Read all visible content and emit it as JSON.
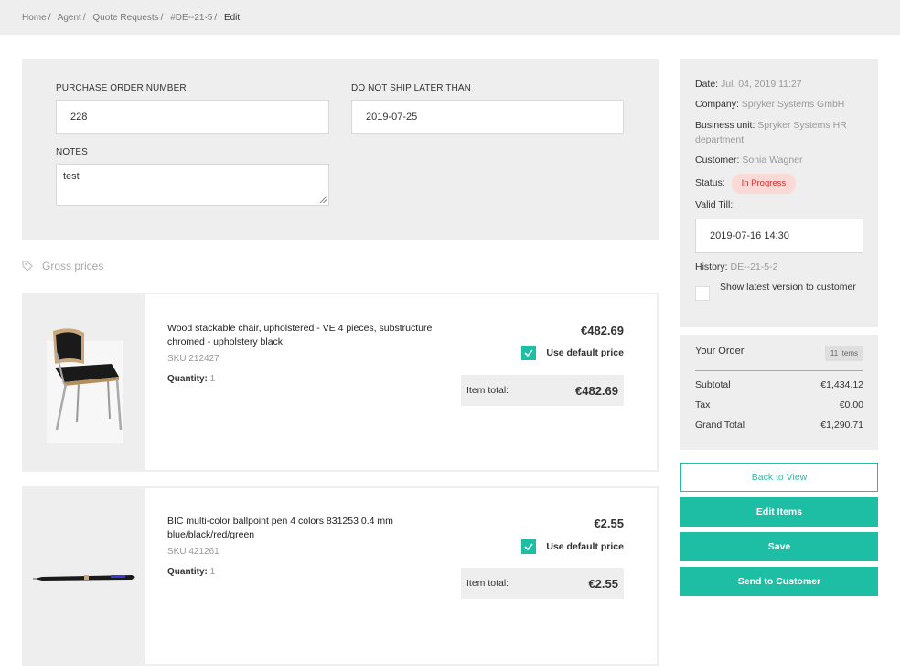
{
  "breadcrumb": [
    "Home",
    "Agent",
    "Quote Requests",
    "#DE--21-5",
    "Edit"
  ],
  "form": {
    "po_label": "PURCHASE ORDER NUMBER",
    "po_value": "228",
    "ship_label": "DO NOT SHIP LATER THAN",
    "ship_value": "2019-07-25",
    "notes_label": "NOTES",
    "notes_value": "test"
  },
  "gross_prices": "Gross prices",
  "items": [
    {
      "name": "Wood stackable chair, upholstered - VE 4 pieces, substructure chromed - upholstery black",
      "sku": "SKU 212427",
      "qty_label": "Quantity:",
      "qty": "1",
      "price": "€482.69",
      "default_price_label": "Use default price",
      "total_label": "Item total:",
      "total": "€482.69",
      "image": "chair-image"
    },
    {
      "name": "BIC multi-color ballpoint pen 4 colors 831253 0.4 mm blue/black/red/green",
      "sku": "SKU 421261",
      "qty_label": "Quantity:",
      "qty": "1",
      "price": "€2.55",
      "default_price_label": "Use default price",
      "total_label": "Item total:",
      "total": "€2.55",
      "image": "pen-image"
    }
  ],
  "info": {
    "date_label": "Date:",
    "date": "Jul. 04, 2019 11:27",
    "company_label": "Company:",
    "company": "Spryker Systems GmbH",
    "bu_label": "Business unit:",
    "bu": "Spryker Systems HR department",
    "customer_label": "Customer:",
    "customer": "Sonia Wagner",
    "status_label": "Status:",
    "status": "In Progress",
    "valid_label": "Valid Till:",
    "valid_value": "2019-07-16 14:30",
    "history_label": "History:",
    "history": "DE--21-5-2",
    "latest_label": "Show latest version to customer"
  },
  "order": {
    "title": "Your Order",
    "count": "11 Items",
    "subtotal_label": "Subtotal",
    "subtotal": "€1,434.12",
    "tax_label": "Tax",
    "tax": "€0.00",
    "grand_label": "Grand Total",
    "grand": "€1,290.71"
  },
  "buttons": {
    "back": "Back to View",
    "edit": "Edit Items",
    "save": "Save",
    "send": "Send to Customer"
  },
  "colors": {
    "accent": "#1ebea5",
    "panel": "#eeeeee",
    "status_bg": "#fbd9d5",
    "status_text": "#d0312d"
  }
}
